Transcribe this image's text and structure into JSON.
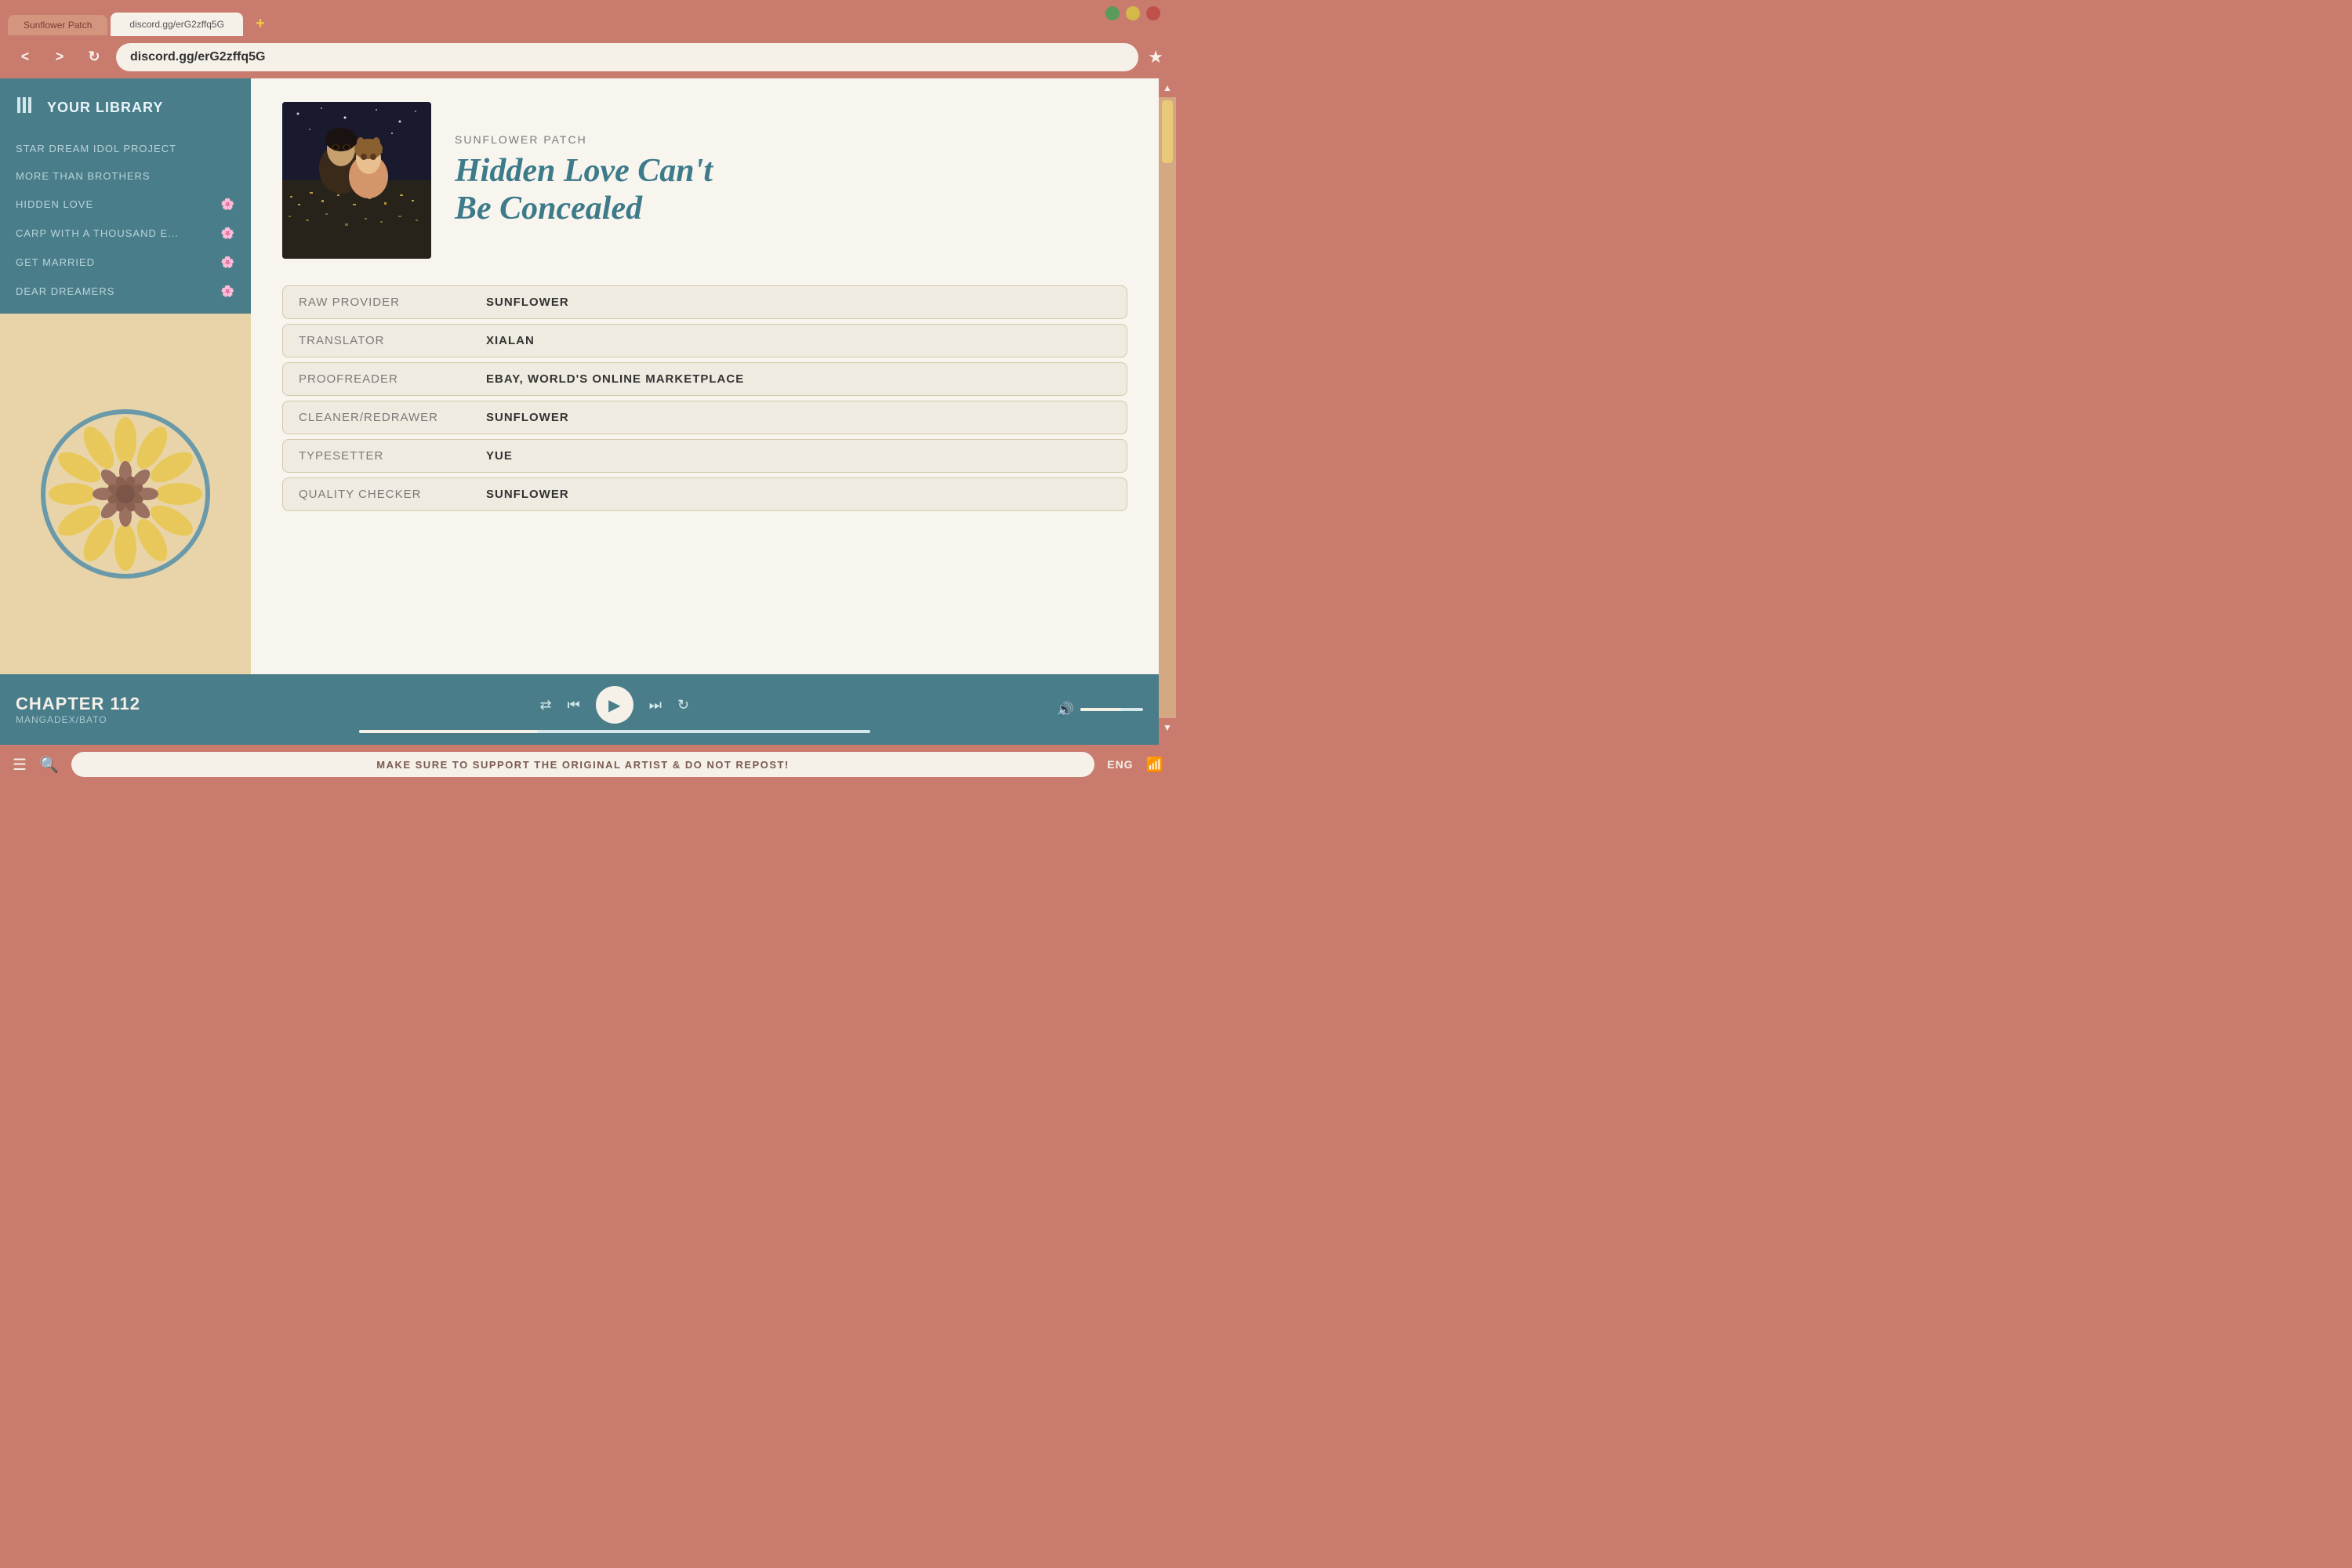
{
  "browser": {
    "tab_inactive": "Sunflower Patch",
    "tab_active": "discord.gg/erG2zffq5G",
    "tab_new_label": "+",
    "address_bar": "discord.gg/erG2zffq5G",
    "wc_green": "green",
    "wc_yellow": "yellow",
    "wc_red": "red"
  },
  "nav": {
    "back_label": "<",
    "forward_label": ">",
    "reload_label": "↻",
    "bookmark_label": "★"
  },
  "sidebar": {
    "title": "YOUR LIBRARY",
    "icon": "|||",
    "items": [
      {
        "label": "STAR DREAM IDOL PROJECT",
        "has_icon": false
      },
      {
        "label": "MORE THAN BROTHERS",
        "has_icon": false
      },
      {
        "label": "HIDDEN LOVE",
        "has_icon": true
      },
      {
        "label": "CARP WITH A THOUSAND E...",
        "has_icon": true
      },
      {
        "label": "GET MARRIED",
        "has_icon": true
      },
      {
        "label": "DEAR DREAMERS",
        "has_icon": true
      }
    ]
  },
  "book": {
    "publisher": "SUNFLOWER PATCH",
    "title_line1": "Hidden Love Can't",
    "title_line2": "Be Concealed"
  },
  "credits": [
    {
      "role": "RAW PROVIDER",
      "name": "SUNFLOWER"
    },
    {
      "role": "TRANSLATOR",
      "name": "XIALAN"
    },
    {
      "role": "PROOFREADER",
      "name": "EBAY, WORLD'S ONLINE MARKETPLACE"
    },
    {
      "role": "CLEANER/REDRAWER",
      "name": "SUNFLOWER"
    },
    {
      "role": "TYPESETTER",
      "name": "YUE"
    },
    {
      "role": "QUALITY CHECKER",
      "name": "SUNFLOWER"
    }
  ],
  "player": {
    "chapter": "CHAPTER 112",
    "source": "MANGADEX/BATO",
    "play_icon": "▶",
    "prev_icon": "⏮",
    "next_icon": "⏭",
    "shuffle_icon": "⇄",
    "repeat_icon": "↻",
    "volume_icon": "🔊"
  },
  "status_bar": {
    "menu_icon": "☰",
    "search_icon": "🔍",
    "message": "MAKE SURE TO SUPPORT THE ORIGINAL ARTIST & DO NOT REPOST!",
    "language": "ENG",
    "wifi_icon": "📶"
  },
  "colors": {
    "browser_chrome": "#c97b6e",
    "sidebar_bg": "#4a7d8a",
    "content_bg": "#f8f5ef",
    "title_color": "#3d7a8a",
    "credit_bg": "#f0ebe0",
    "credit_border": "#d4c9a8"
  }
}
